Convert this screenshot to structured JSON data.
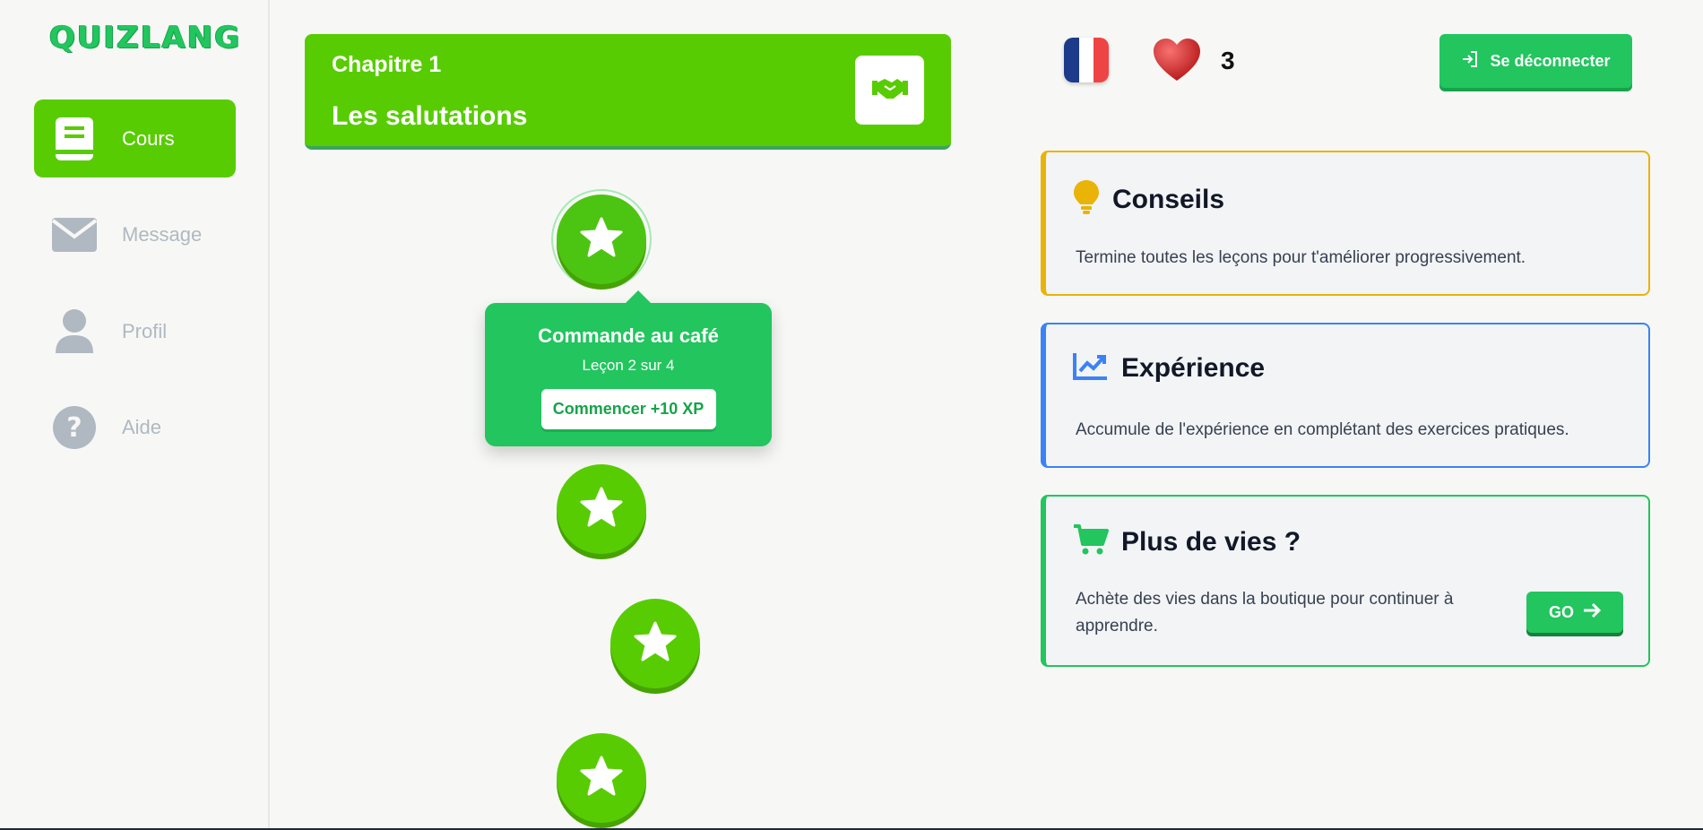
{
  "app": {
    "logo": "QUIZLANG"
  },
  "sidebar": {
    "items": [
      {
        "label": "Cours",
        "icon": "book-icon",
        "active": true
      },
      {
        "label": "Message",
        "icon": "envelope-icon",
        "active": false
      },
      {
        "label": "Profil",
        "icon": "user-icon",
        "active": false
      },
      {
        "label": "Aide",
        "icon": "question-circle-icon",
        "active": false
      }
    ]
  },
  "chapter": {
    "subtitle": "Chapitre 1",
    "title": "Les salutations",
    "icon": "handshake-icon"
  },
  "lesson_popup": {
    "title": "Commande au café",
    "progress": "Leçon 2 sur 4",
    "button": "Commencer +10 XP"
  },
  "header": {
    "language_flag": "france-flag-icon",
    "lives_count": "3",
    "logout_label": "Se déconnecter"
  },
  "cards": {
    "tips": {
      "title": "Conseils",
      "text": "Termine toutes les leçons pour t'améliorer progressivement.",
      "color": "#eab308"
    },
    "experience": {
      "title": "Expérience",
      "text": "Accumule de l'expérience en complétant des exercices pratiques.",
      "color": "#3b82f6"
    },
    "lives": {
      "title": "Plus de vies ?",
      "text": "Achète des vies dans la boutique pour continuer à apprendre.",
      "button": "GO",
      "color": "#22c55e"
    }
  },
  "colors": {
    "primary_green": "#58cc02",
    "accent_green": "#22c55e",
    "muted": "#b0b8c1"
  }
}
